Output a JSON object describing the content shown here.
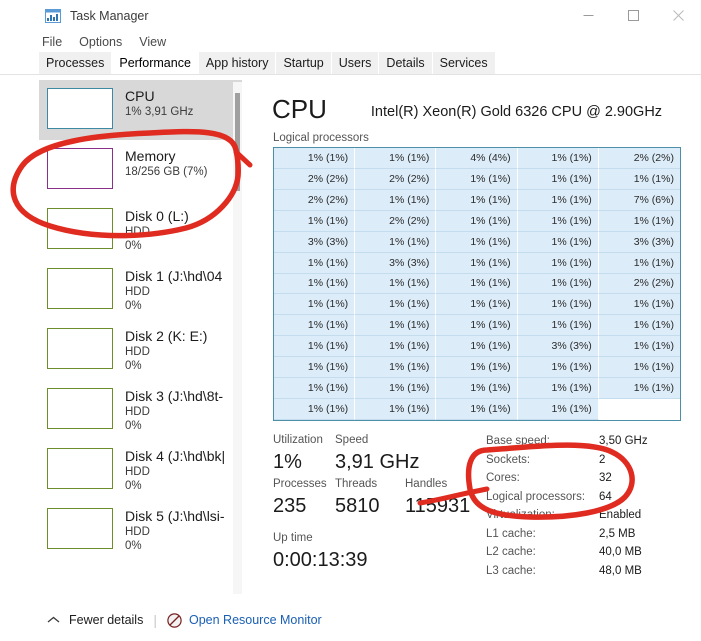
{
  "window": {
    "title": "Task Manager",
    "icon": "taskmanager-icon",
    "minimize_label": "Minimize",
    "maximize_label": "Maximize",
    "close_label": "Close"
  },
  "menu": {
    "items": [
      {
        "label": "File"
      },
      {
        "label": "Options"
      },
      {
        "label": "View"
      }
    ]
  },
  "tabs": [
    {
      "label": "Processes",
      "active": false
    },
    {
      "label": "Performance",
      "active": true
    },
    {
      "label": "App history",
      "active": false
    },
    {
      "label": "Startup",
      "active": false
    },
    {
      "label": "Users",
      "active": false
    },
    {
      "label": "Details",
      "active": false
    },
    {
      "label": "Services",
      "active": false
    }
  ],
  "sidebar": {
    "items": [
      {
        "title": "CPU",
        "line2": "1%  3,91 GHz",
        "line3": "",
        "kind": "cpu",
        "selected": true
      },
      {
        "title": "Memory",
        "line2": "18/256 GB (7%)",
        "line3": "",
        "kind": "mem",
        "selected": false
      },
      {
        "title": "Disk 0 (L:)",
        "line2": "HDD",
        "line3": "0%",
        "kind": "disk",
        "selected": false
      },
      {
        "title": "Disk 1 (J:\\hd\\04",
        "line2": "HDD",
        "line3": "0%",
        "kind": "disk",
        "selected": false
      },
      {
        "title": "Disk 2 (K: E:)",
        "line2": "HDD",
        "line3": "0%",
        "kind": "disk",
        "selected": false
      },
      {
        "title": "Disk 3 (J:\\hd\\8t-",
        "line2": "HDD",
        "line3": "0%",
        "kind": "disk",
        "selected": false
      },
      {
        "title": "Disk 4 (J:\\hd\\bk|",
        "line2": "HDD",
        "line3": "0%",
        "kind": "disk",
        "selected": false
      },
      {
        "title": "Disk 5 (J:\\hd\\lsi-",
        "line2": "HDD",
        "line3": "0%",
        "kind": "disk",
        "selected": false
      }
    ]
  },
  "cpu": {
    "heading": "CPU",
    "model": "Intel(R) Xeon(R) Gold 6326 CPU @ 2.90GHz",
    "logical_processors_label": "Logical processors",
    "grid": {
      "columns": 5,
      "rows": 13,
      "cells": [
        "1% (1%)",
        "1% (1%)",
        "4% (4%)",
        "1% (1%)",
        "2% (2%)",
        "2% (2%)",
        "2% (2%)",
        "1% (1%)",
        "1% (1%)",
        "1% (1%)",
        "2% (2%)",
        "1% (1%)",
        "1% (1%)",
        "1% (1%)",
        "7% (6%)",
        "1% (1%)",
        "2% (2%)",
        "1% (1%)",
        "1% (1%)",
        "1% (1%)",
        "3% (3%)",
        "1% (1%)",
        "1% (1%)",
        "1% (1%)",
        "3% (3%)",
        "1% (1%)",
        "3% (3%)",
        "1% (1%)",
        "1% (1%)",
        "1% (1%)",
        "1% (1%)",
        "1% (1%)",
        "1% (1%)",
        "1% (1%)",
        "2% (2%)",
        "1% (1%)",
        "1% (1%)",
        "1% (1%)",
        "1% (1%)",
        "1% (1%)",
        "1% (1%)",
        "1% (1%)",
        "1% (1%)",
        "1% (1%)",
        "1% (1%)",
        "1% (1%)",
        "1% (1%)",
        "1% (1%)",
        "3% (3%)",
        "1% (1%)",
        "1% (1%)",
        "1% (1%)",
        "1% (1%)",
        "1% (1%)",
        "1% (1%)",
        "1% (1%)",
        "1% (1%)",
        "1% (1%)",
        "1% (1%)",
        "1% (1%)",
        "1% (1%)",
        "1% (1%)",
        "1% (1%)",
        "1% (1%)",
        ""
      ]
    },
    "stats": {
      "utilization_label": "Utilization",
      "utilization_value": "1%",
      "speed_label": "Speed",
      "speed_value": "3,91 GHz",
      "processes_label": "Processes",
      "processes_value": "235",
      "threads_label": "Threads",
      "threads_value": "5810",
      "handles_label": "Handles",
      "handles_value": "115931",
      "uptime_label": "Up time",
      "uptime_value": "0:00:13:39"
    },
    "specs": [
      {
        "key": "Base speed:",
        "value": "3,50 GHz"
      },
      {
        "key": "Sockets:",
        "value": "2"
      },
      {
        "key": "Cores:",
        "value": "32"
      },
      {
        "key": "Logical processors:",
        "value": "64"
      },
      {
        "key": "Virtualization:",
        "value": "Enabled"
      },
      {
        "key": "L1 cache:",
        "value": "2,5 MB"
      },
      {
        "key": "L2 cache:",
        "value": "40,0 MB"
      },
      {
        "key": "L3 cache:",
        "value": "48,0 MB"
      }
    ]
  },
  "footer": {
    "fewer_details_label": "Fewer details",
    "chevron_icon": "chevron-up-icon",
    "resource_monitor_icon": "resource-monitor-icon",
    "resource_monitor_label": "Open Resource Monitor"
  },
  "annotations": {
    "color": "#e02b20",
    "shapes": [
      {
        "name": "memory-highlight-ellipse"
      },
      {
        "name": "cpu-specs-highlight-ellipse"
      }
    ]
  },
  "colors": {
    "cpu_accent": "#3e8aa5",
    "memory_accent": "#8a2f8a",
    "disk_accent": "#6d8c2a",
    "grid_fill": "#dcecf8",
    "link": "#1a5fb4",
    "annotation_red": "#e02b20"
  }
}
